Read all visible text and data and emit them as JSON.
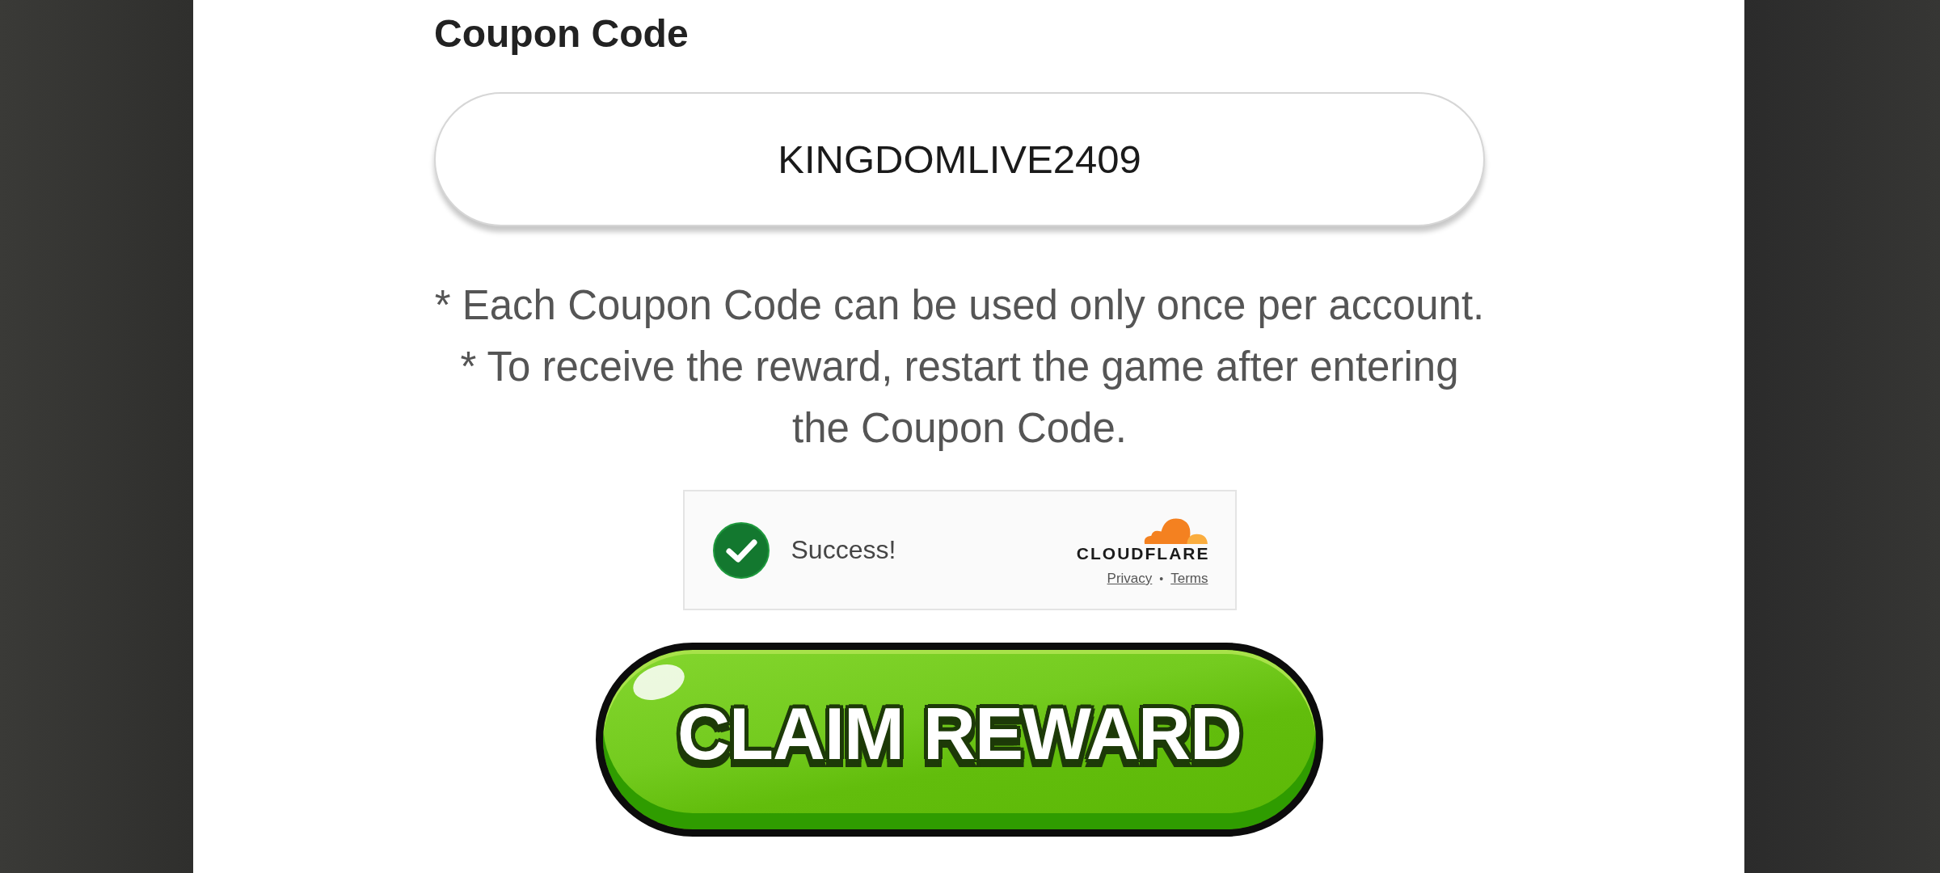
{
  "coupon": {
    "label": "Coupon Code",
    "value": "KINGDOMLIVE2409"
  },
  "notes": [
    "* Each Coupon Code can be used only once per account.",
    "* To receive the reward, restart the game after entering the Coupon Code."
  ],
  "captcha": {
    "verified": true,
    "status": "Success!",
    "brand": "CLOUDFLARE",
    "links": [
      {
        "label": "Privacy"
      },
      {
        "label": "Terms"
      }
    ],
    "separator": "•"
  },
  "submit_button": {
    "label": "CLAIM REWARD"
  }
}
